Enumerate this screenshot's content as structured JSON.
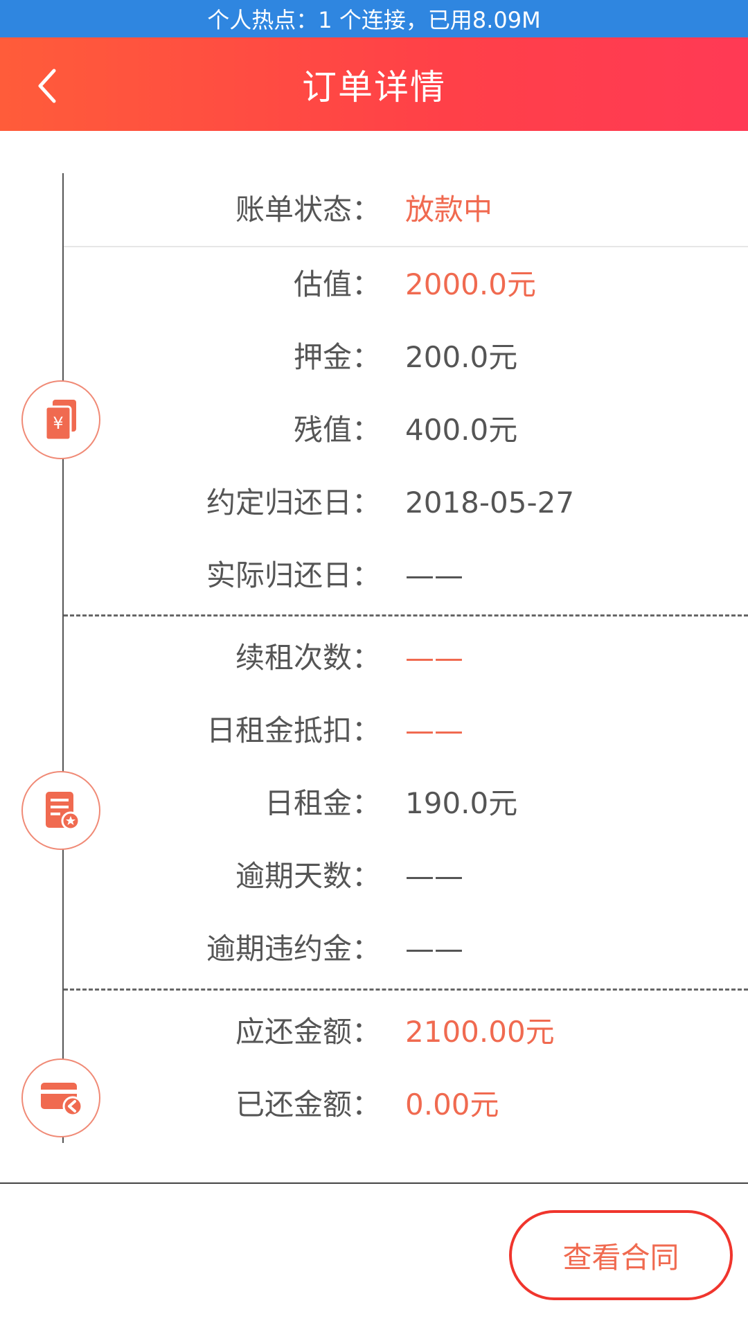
{
  "status_bar": {
    "text": "个人热点：1 个连接，已用8.09M"
  },
  "nav": {
    "title": "订单详情"
  },
  "bill_status": {
    "label": "账单状态：",
    "value": "放款中"
  },
  "section1": [
    {
      "label": "估值：",
      "value": "2000.0元",
      "highlight": true
    },
    {
      "label": "押金：",
      "value": "200.0元",
      "highlight": false
    },
    {
      "label": "残值：",
      "value": "400.0元",
      "highlight": false
    },
    {
      "label": "约定归还日：",
      "value": "2018-05-27",
      "highlight": false
    },
    {
      "label": "实际归还日：",
      "value": "——",
      "highlight": false
    }
  ],
  "section2": [
    {
      "label": "续租次数：",
      "value": "——",
      "highlight": true
    },
    {
      "label": "日租金抵扣：",
      "value": "——",
      "highlight": true
    },
    {
      "label": "日租金：",
      "value": "190.0元",
      "highlight": false
    },
    {
      "label": "逾期天数：",
      "value": "——",
      "highlight": false
    },
    {
      "label": "逾期违约金：",
      "value": "——",
      "highlight": false
    }
  ],
  "section3": [
    {
      "label": "应还金额：",
      "value": "2100.00元",
      "highlight": true
    },
    {
      "label": "已还金额：",
      "value": "0.00元",
      "highlight": true
    }
  ],
  "icons": {
    "section1": "yuan-document-icon",
    "section2": "certificate-icon",
    "section3": "card-return-icon"
  },
  "footer": {
    "contract_button": "查看合同"
  },
  "colors": {
    "accent": "#f06a50",
    "nav_gradient_start": "#ff5c3a",
    "nav_gradient_end": "#ff3a55",
    "status_bar": "#2f86e0"
  }
}
